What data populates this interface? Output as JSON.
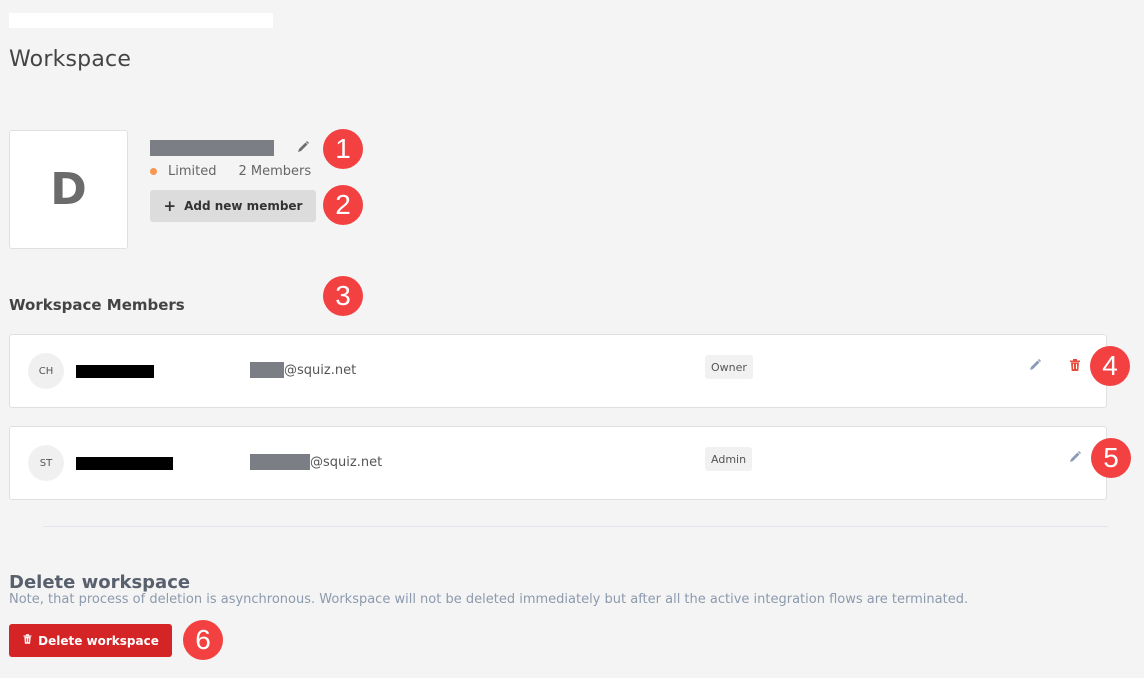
{
  "page": {
    "title": "Workspace"
  },
  "workspace": {
    "avatar_letter": "D",
    "name": "[redacted]",
    "plan": "Limited",
    "plan_color": "#f7964f",
    "member_count": "2 Members",
    "add_member_label": "Add new member"
  },
  "members_section": {
    "title": "Workspace Members",
    "members": [
      {
        "initials": "CH",
        "name": "[redacted]",
        "email_domain": "@squiz.net",
        "role": "Owner",
        "can_delete": true
      },
      {
        "initials": "ST",
        "name": "[redacted]",
        "email_domain": "@squiz.net",
        "role": "Admin",
        "can_delete": false
      }
    ]
  },
  "delete_section": {
    "title": "Delete workspace",
    "note": "Note, that process of deletion is asynchronous. Workspace will not be deleted immediately but after all the active integration flows are terminated.",
    "button_label": "Delete workspace",
    "button_color": "#d42426"
  },
  "annotations": [
    "1",
    "2",
    "3",
    "4",
    "5",
    "6"
  ]
}
